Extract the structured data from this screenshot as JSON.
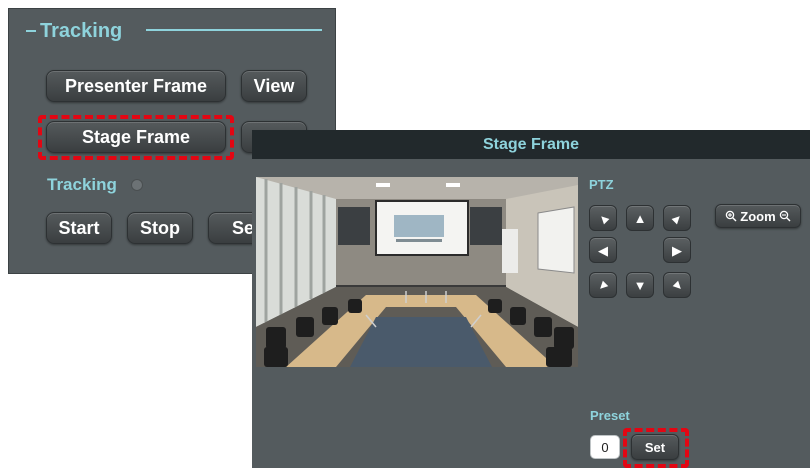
{
  "tracking_panel": {
    "header": "Tracking",
    "presenter_frame_label": "Presenter Frame",
    "view_label": "View",
    "stage_frame_label": "Stage Frame",
    "tracking_status_label": "Tracking",
    "start_label": "Start",
    "stop_label": "Stop",
    "set_label_clipped": "Se"
  },
  "stage_dialog": {
    "title": "Stage Frame",
    "ptz_label": "PTZ",
    "ptz_buttons": [
      "arrow-up-left-icon",
      "arrow-up-icon",
      "arrow-up-right-icon",
      "arrow-left-icon",
      "arrow-right-icon",
      "arrow-down-left-icon",
      "arrow-down-icon",
      "arrow-down-right-icon"
    ],
    "zoom_label": "Zoom",
    "preset_label": "Preset",
    "preset_value": "0",
    "set_label": "Set"
  },
  "colors": {
    "panel_bg": "#545b5e",
    "accent": "#8ed3dc",
    "title_bar": "#22292c",
    "highlight": "#e30613"
  }
}
